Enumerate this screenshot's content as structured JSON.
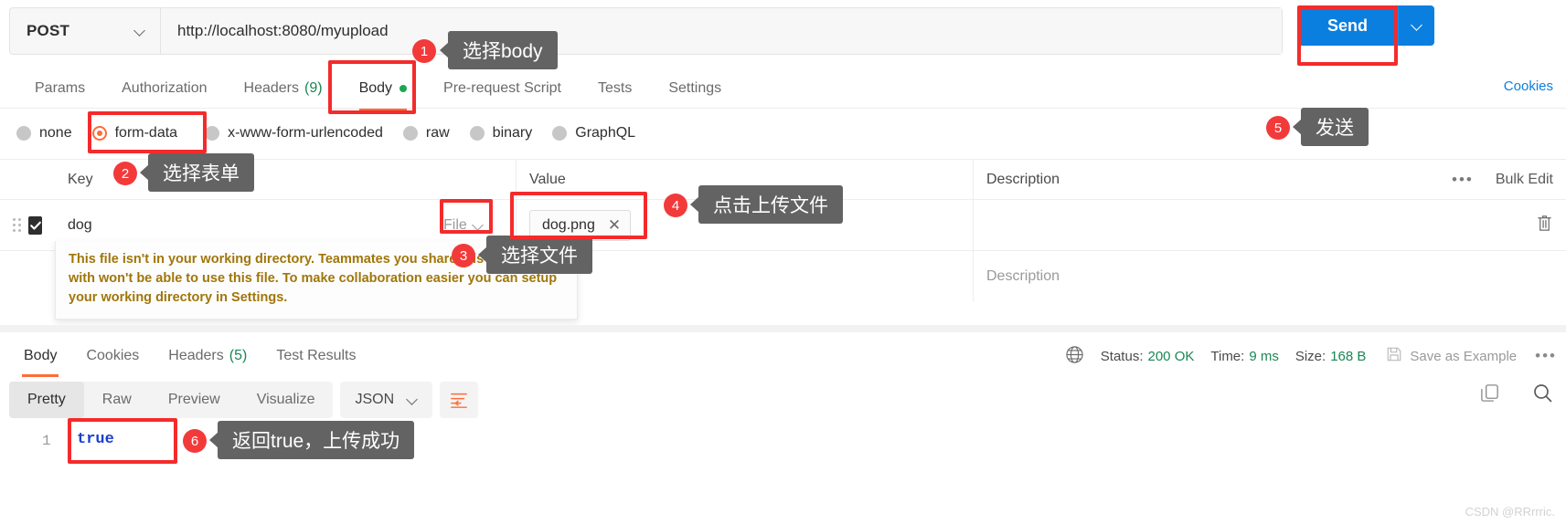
{
  "request": {
    "method": "POST",
    "url": "http://localhost:8080/myupload",
    "send_label": "Send",
    "cookies_label": "Cookies",
    "tabs": [
      {
        "label": "Params",
        "count": "",
        "active": false,
        "dot": false
      },
      {
        "label": "Authorization",
        "count": "",
        "active": false,
        "dot": false
      },
      {
        "label": "Headers",
        "count": "(9)",
        "active": false,
        "dot": false
      },
      {
        "label": "Body",
        "count": "",
        "active": true,
        "dot": true
      },
      {
        "label": "Pre-request Script",
        "count": "",
        "active": false,
        "dot": false
      },
      {
        "label": "Tests",
        "count": "",
        "active": false,
        "dot": false
      },
      {
        "label": "Settings",
        "count": "",
        "active": false,
        "dot": false
      }
    ],
    "body_types": [
      {
        "label": "none",
        "selected": false
      },
      {
        "label": "form-data",
        "selected": true
      },
      {
        "label": "x-www-form-urlencoded",
        "selected": false
      },
      {
        "label": "raw",
        "selected": false
      },
      {
        "label": "binary",
        "selected": false
      },
      {
        "label": "GraphQL",
        "selected": false
      }
    ],
    "table": {
      "headers": [
        "Key",
        "Value",
        "Description"
      ],
      "bulk_edit_label": "Bulk Edit",
      "rows": [
        {
          "checked": true,
          "key": "dog",
          "type": "File",
          "file_name": "dog.png",
          "description_placeholder": ""
        },
        {
          "checked": false,
          "key": "",
          "type": "",
          "file_name": "",
          "description_placeholder": "Description"
        }
      ],
      "warning": "This file isn't in your working directory. Teammates you share this request with won't be able to use this file. To make collaboration easier you can setup your working directory in Settings."
    }
  },
  "response": {
    "tabs": [
      {
        "label": "Body",
        "count": "",
        "active": true
      },
      {
        "label": "Cookies",
        "count": "",
        "active": false
      },
      {
        "label": "Headers",
        "count": "(5)",
        "active": false
      },
      {
        "label": "Test Results",
        "count": "",
        "active": false
      }
    ],
    "status": {
      "status_label": "Status:",
      "status_value": "200 OK",
      "time_label": "Time:",
      "time_value": "9 ms",
      "size_label": "Size:",
      "size_value": "168 B"
    },
    "save_example_label": "Save as Example",
    "format_tabs": [
      {
        "label": "Pretty",
        "active": true
      },
      {
        "label": "Raw",
        "active": false
      },
      {
        "label": "Preview",
        "active": false
      },
      {
        "label": "Visualize",
        "active": false
      }
    ],
    "content_type": "JSON",
    "line_number": "1",
    "body_text": "true"
  },
  "annotations": [
    {
      "number": "1",
      "text": "选择body"
    },
    {
      "number": "2",
      "text": "选择表单"
    },
    {
      "number": "3",
      "text": "选择文件"
    },
    {
      "number": "4",
      "text": "点击上传文件"
    },
    {
      "number": "5",
      "text": "发送"
    },
    {
      "number": "6",
      "text": "返回true，上传成功"
    }
  ],
  "watermark": "CSDN @RRrrric.",
  "colors": {
    "accent": "#ff6c37",
    "send": "#0b7fe0",
    "success": "#1a8754",
    "annotation": "#f42b2b"
  }
}
